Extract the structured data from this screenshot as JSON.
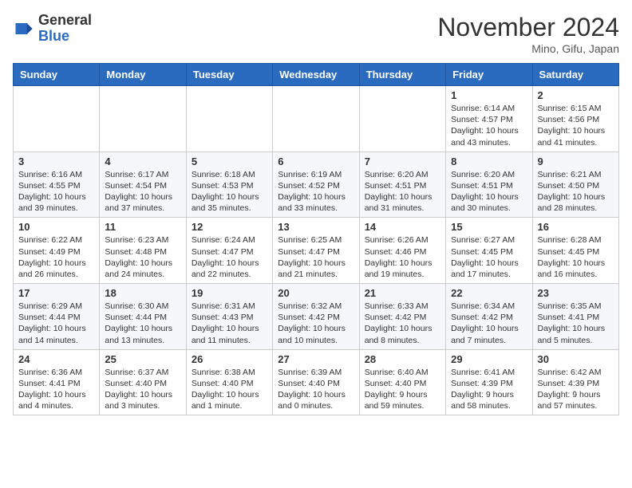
{
  "header": {
    "logo_general": "General",
    "logo_blue": "Blue",
    "month_title": "November 2024",
    "location": "Mino, Gifu, Japan"
  },
  "weekdays": [
    "Sunday",
    "Monday",
    "Tuesday",
    "Wednesday",
    "Thursday",
    "Friday",
    "Saturday"
  ],
  "weeks": [
    [
      {
        "day": "",
        "info": ""
      },
      {
        "day": "",
        "info": ""
      },
      {
        "day": "",
        "info": ""
      },
      {
        "day": "",
        "info": ""
      },
      {
        "day": "",
        "info": ""
      },
      {
        "day": "1",
        "info": "Sunrise: 6:14 AM\nSunset: 4:57 PM\nDaylight: 10 hours\nand 43 minutes."
      },
      {
        "day": "2",
        "info": "Sunrise: 6:15 AM\nSunset: 4:56 PM\nDaylight: 10 hours\nand 41 minutes."
      }
    ],
    [
      {
        "day": "3",
        "info": "Sunrise: 6:16 AM\nSunset: 4:55 PM\nDaylight: 10 hours\nand 39 minutes."
      },
      {
        "day": "4",
        "info": "Sunrise: 6:17 AM\nSunset: 4:54 PM\nDaylight: 10 hours\nand 37 minutes."
      },
      {
        "day": "5",
        "info": "Sunrise: 6:18 AM\nSunset: 4:53 PM\nDaylight: 10 hours\nand 35 minutes."
      },
      {
        "day": "6",
        "info": "Sunrise: 6:19 AM\nSunset: 4:52 PM\nDaylight: 10 hours\nand 33 minutes."
      },
      {
        "day": "7",
        "info": "Sunrise: 6:20 AM\nSunset: 4:51 PM\nDaylight: 10 hours\nand 31 minutes."
      },
      {
        "day": "8",
        "info": "Sunrise: 6:20 AM\nSunset: 4:51 PM\nDaylight: 10 hours\nand 30 minutes."
      },
      {
        "day": "9",
        "info": "Sunrise: 6:21 AM\nSunset: 4:50 PM\nDaylight: 10 hours\nand 28 minutes."
      }
    ],
    [
      {
        "day": "10",
        "info": "Sunrise: 6:22 AM\nSunset: 4:49 PM\nDaylight: 10 hours\nand 26 minutes."
      },
      {
        "day": "11",
        "info": "Sunrise: 6:23 AM\nSunset: 4:48 PM\nDaylight: 10 hours\nand 24 minutes."
      },
      {
        "day": "12",
        "info": "Sunrise: 6:24 AM\nSunset: 4:47 PM\nDaylight: 10 hours\nand 22 minutes."
      },
      {
        "day": "13",
        "info": "Sunrise: 6:25 AM\nSunset: 4:47 PM\nDaylight: 10 hours\nand 21 minutes."
      },
      {
        "day": "14",
        "info": "Sunrise: 6:26 AM\nSunset: 4:46 PM\nDaylight: 10 hours\nand 19 minutes."
      },
      {
        "day": "15",
        "info": "Sunrise: 6:27 AM\nSunset: 4:45 PM\nDaylight: 10 hours\nand 17 minutes."
      },
      {
        "day": "16",
        "info": "Sunrise: 6:28 AM\nSunset: 4:45 PM\nDaylight: 10 hours\nand 16 minutes."
      }
    ],
    [
      {
        "day": "17",
        "info": "Sunrise: 6:29 AM\nSunset: 4:44 PM\nDaylight: 10 hours\nand 14 minutes."
      },
      {
        "day": "18",
        "info": "Sunrise: 6:30 AM\nSunset: 4:44 PM\nDaylight: 10 hours\nand 13 minutes."
      },
      {
        "day": "19",
        "info": "Sunrise: 6:31 AM\nSunset: 4:43 PM\nDaylight: 10 hours\nand 11 minutes."
      },
      {
        "day": "20",
        "info": "Sunrise: 6:32 AM\nSunset: 4:42 PM\nDaylight: 10 hours\nand 10 minutes."
      },
      {
        "day": "21",
        "info": "Sunrise: 6:33 AM\nSunset: 4:42 PM\nDaylight: 10 hours\nand 8 minutes."
      },
      {
        "day": "22",
        "info": "Sunrise: 6:34 AM\nSunset: 4:42 PM\nDaylight: 10 hours\nand 7 minutes."
      },
      {
        "day": "23",
        "info": "Sunrise: 6:35 AM\nSunset: 4:41 PM\nDaylight: 10 hours\nand 5 minutes."
      }
    ],
    [
      {
        "day": "24",
        "info": "Sunrise: 6:36 AM\nSunset: 4:41 PM\nDaylight: 10 hours\nand 4 minutes."
      },
      {
        "day": "25",
        "info": "Sunrise: 6:37 AM\nSunset: 4:40 PM\nDaylight: 10 hours\nand 3 minutes."
      },
      {
        "day": "26",
        "info": "Sunrise: 6:38 AM\nSunset: 4:40 PM\nDaylight: 10 hours\nand 1 minute."
      },
      {
        "day": "27",
        "info": "Sunrise: 6:39 AM\nSunset: 4:40 PM\nDaylight: 10 hours\nand 0 minutes."
      },
      {
        "day": "28",
        "info": "Sunrise: 6:40 AM\nSunset: 4:40 PM\nDaylight: 9 hours\nand 59 minutes."
      },
      {
        "day": "29",
        "info": "Sunrise: 6:41 AM\nSunset: 4:39 PM\nDaylight: 9 hours\nand 58 minutes."
      },
      {
        "day": "30",
        "info": "Sunrise: 6:42 AM\nSunset: 4:39 PM\nDaylight: 9 hours\nand 57 minutes."
      }
    ]
  ]
}
